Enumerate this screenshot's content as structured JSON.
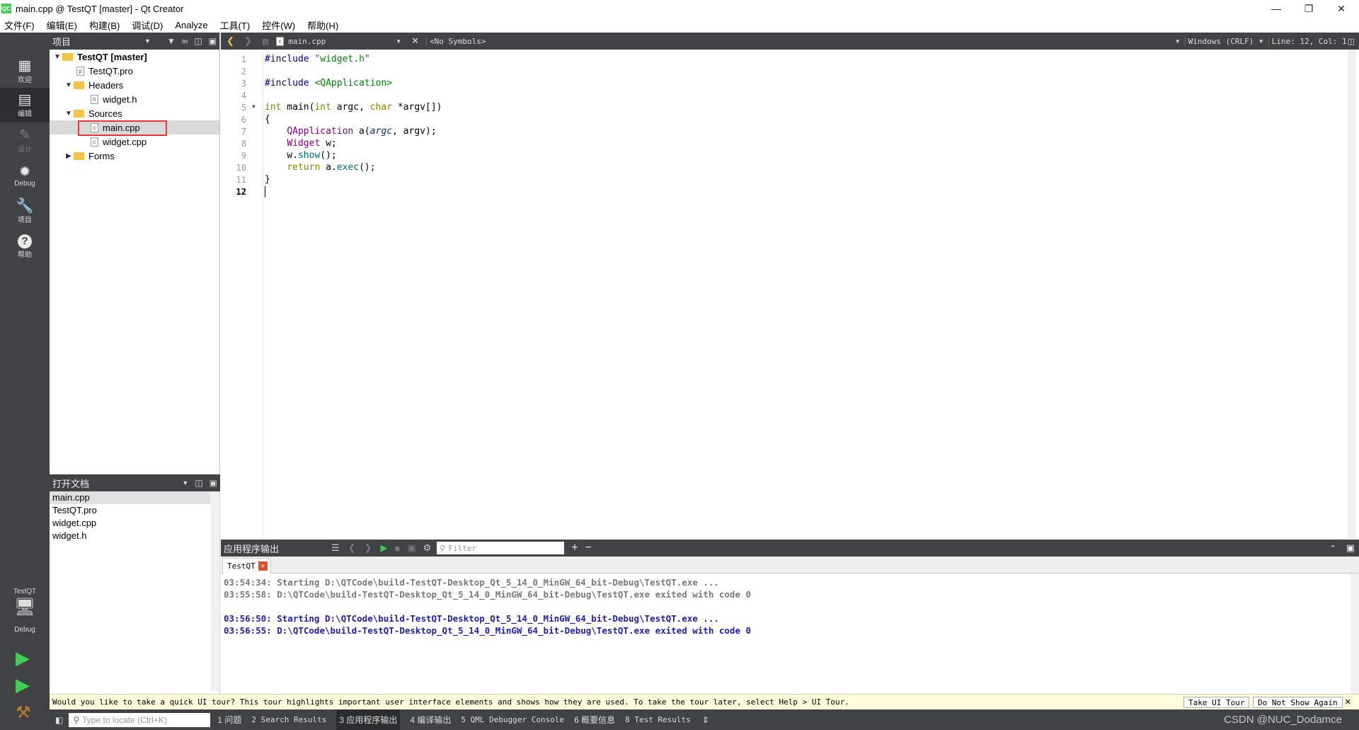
{
  "window": {
    "title": "main.cpp @ TestQT [master] - Qt Creator",
    "app_icon": "QC"
  },
  "menu": [
    "文件(F)",
    "编辑(E)",
    "构建(B)",
    "调试(D)",
    "Analyze",
    "工具(T)",
    "控件(W)",
    "帮助(H)"
  ],
  "modes": [
    {
      "label": "欢迎",
      "icon": "grid-icon"
    },
    {
      "label": "编辑",
      "icon": "edit-icon"
    },
    {
      "label": "设计",
      "icon": "pencil-icon"
    },
    {
      "label": "Debug",
      "icon": "bug-icon"
    },
    {
      "label": "项目",
      "icon": "wrench-icon"
    },
    {
      "label": "帮助",
      "icon": "help-icon"
    }
  ],
  "kit": {
    "project": "TestQT",
    "mode": "Debug"
  },
  "project_panel": {
    "title": "项目",
    "tree": [
      {
        "label": "TestQT [master]",
        "bold": true
      },
      {
        "label": "TestQT.pro"
      },
      {
        "label": "Headers"
      },
      {
        "label": "widget.h"
      },
      {
        "label": "Sources"
      },
      {
        "label": "main.cpp"
      },
      {
        "label": "widget.cpp"
      },
      {
        "label": "Forms"
      }
    ]
  },
  "open_docs": {
    "title": "打开文档",
    "items": [
      "main.cpp",
      "TestQT.pro",
      "widget.cpp",
      "widget.h"
    ]
  },
  "editor_bar": {
    "file": "main.cpp",
    "symbols": "<No Symbols>",
    "encoding": "Windows (CRLF)",
    "position": "Line: 12, Col: 1"
  },
  "line_numbers": [
    "1",
    "2",
    "3",
    "4",
    "5",
    "6",
    "7",
    "8",
    "9",
    "10",
    "11",
    "12"
  ],
  "code": {
    "l1a": "#include ",
    "l1b": "\"widget.h\"",
    "l3a": "#include ",
    "l3b": "<QApplication>",
    "l5a": "int",
    "l5b": " main(",
    "l5c": "int",
    "l5d": " argc, ",
    "l5e": "char",
    "l5f": " *argv[])",
    "l6": "{",
    "l7a": "    ",
    "l7b": "QApplication",
    "l7c": " a(",
    "l7d": "argc",
    "l7e": ", argv);",
    "l8a": "    ",
    "l8b": "Widget",
    "l8c": " w;",
    "l9a": "    w.",
    "l9b": "show",
    "l9c": "();",
    "l10a": "    ",
    "l10b": "return",
    "l10c": " a.",
    "l10d": "exec",
    "l10e": "();",
    "l11": "}"
  },
  "output": {
    "title": "应用程序输出",
    "filter_placeholder": "Filter",
    "tab": "TestQT",
    "lines": [
      "03:54:34: Starting D:\\QTCode\\build-TestQT-Desktop_Qt_5_14_0_MinGW_64_bit-Debug\\TestQT.exe ...",
      "03:55:58: D:\\QTCode\\build-TestQT-Desktop_Qt_5_14_0_MinGW_64_bit-Debug\\TestQT.exe exited with code 0",
      "03:56:50: Starting D:\\QTCode\\build-TestQT-Desktop_Qt_5_14_0_MinGW_64_bit-Debug\\TestQT.exe ...",
      "03:56:55: D:\\QTCode\\build-TestQT-Desktop_Qt_5_14_0_MinGW_64_bit-Debug\\TestQT.exe exited with code 0"
    ],
    "colors": {
      "old": "#7a7a7a",
      "new": "#1f1fa8"
    }
  },
  "infobar": {
    "text": "Would you like to take a quick UI tour? This tour highlights important user interface elements and shows how they are used. To take the tour later, select Help > UI Tour.",
    "take": "Take UI Tour",
    "dismiss": "Do Not Show Again"
  },
  "statusbar": {
    "locate_placeholder": "Type to locate (Ctrl+K)",
    "panes": [
      "1 问题",
      "2 Search Results",
      "3 应用程序输出",
      "4 编译输出",
      "5 QML Debugger Console",
      "6 概要信息",
      "8 Test Results"
    ],
    "watermark": "CSDN @NUC_Dodamce"
  }
}
